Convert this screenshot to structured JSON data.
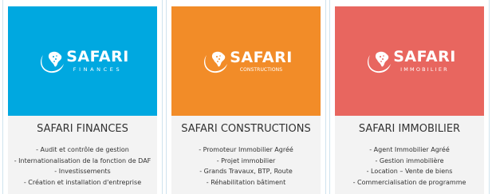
{
  "cards": [
    {
      "logo": {
        "brand": "SAFARI",
        "subtitle": "FINANCES"
      },
      "title": "SAFARI FINANCES",
      "items": [
        "- Audit et contrôle de gestion",
        "- Internationalisation de la fonction de DAF",
        "- Investissements",
        "- Création et installation d'entreprise"
      ]
    },
    {
      "logo": {
        "brand": "SAFARI",
        "subtitle": "CONSTRUCTIONS"
      },
      "title": "SAFARI CONSTRUCTIONS",
      "items": [
        "- Promoteur Immobilier Agréé",
        "- Projet immobilier",
        "- Grands Travaux, BTP, Route",
        "- Réhabilitation bâtiment"
      ]
    },
    {
      "logo": {
        "brand": "SAFARI",
        "subtitle": "IMMOBILIER"
      },
      "title": "SAFARI IMMOBILIER",
      "items": [
        "- Agent Immobilier Agréé",
        "- Gestion immobilière",
        "- Location – Vente de biens",
        "- Commercialisation de programme"
      ]
    }
  ],
  "colors": {
    "finances": "#00a8e0",
    "constructions": "#f28c28",
    "immobilier": "#e8665f",
    "panel": "#f3f3f3",
    "text": "#333333"
  }
}
